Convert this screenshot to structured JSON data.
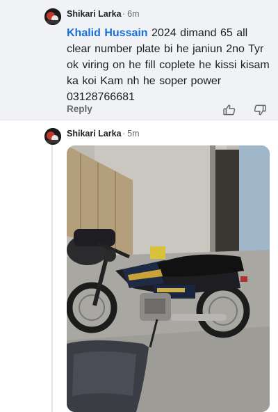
{
  "comment": {
    "author": "Shikari Larka",
    "separator": "·",
    "time": "6m",
    "mention": "Khalid Hussain",
    "text": " 2024  dimand  65 all clear number plate bi he janiun 2no Tyr ok viring on he fill coplete he kissi kisam ka koi Kam nh he  soper power 03128766681",
    "reply_label": "Reply",
    "like_icon": "thumbs-up-icon",
    "dislike_icon": "thumbs-down-icon"
  },
  "reply": {
    "author": "Shikari Larka",
    "separator": "·",
    "time": "5m",
    "photo": "motorcycle-photo"
  },
  "colors": {
    "background_top": "#f0f2f5",
    "mention": "#1a6fd6",
    "muted": "#65676b",
    "thread_line": "#e1e3e7"
  }
}
